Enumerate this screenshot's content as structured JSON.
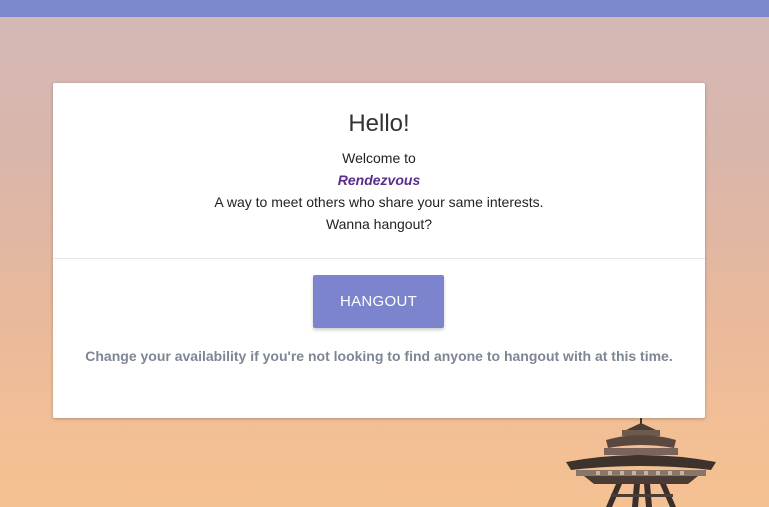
{
  "card": {
    "greeting": "Hello!",
    "welcome": "Welcome to",
    "brand": "Rendezvous",
    "tagline": "A way to meet others who share your same interests.",
    "question": "Wanna hangout?"
  },
  "actions": {
    "hangout_label": "HANGOUT"
  },
  "note": "Change your availability if you're not looking to find anyone to hangout with at this time.",
  "colors": {
    "topbar": "#7b89cc",
    "button": "#7b84cc",
    "brand": "#5a2d8c",
    "note": "#7d8694"
  },
  "icons": {
    "background": "space-needle-tower"
  }
}
